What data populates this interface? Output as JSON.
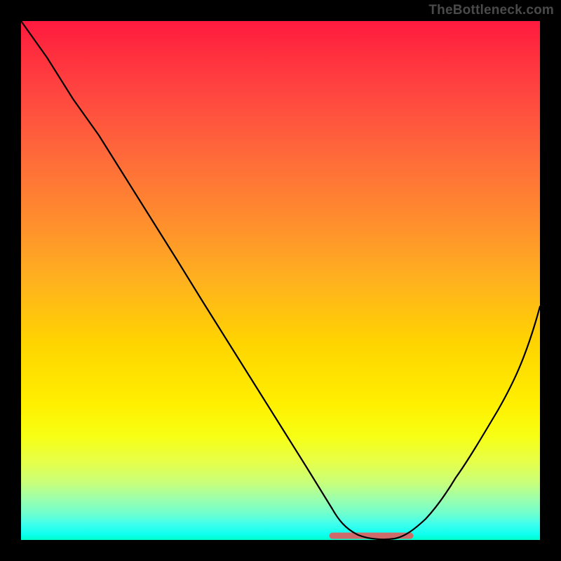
{
  "watermark": "TheBottleneck.com",
  "chart_data": {
    "type": "line",
    "title": "",
    "xlabel": "",
    "ylabel": "",
    "xlim": [
      0,
      100
    ],
    "ylim": [
      0,
      100
    ],
    "grid": false,
    "series": [
      {
        "name": "bottleneck-curve",
        "color": "#000000",
        "x": [
          0,
          5,
          10,
          15,
          20,
          25,
          30,
          35,
          40,
          45,
          50,
          55,
          60,
          62,
          65,
          68,
          72,
          75,
          78,
          82,
          86,
          90,
          94,
          100
        ],
        "values": [
          100,
          93,
          85,
          78,
          70,
          62,
          54,
          46,
          38,
          30,
          22,
          14,
          6,
          3,
          1,
          0,
          0,
          1,
          3,
          8,
          15,
          23,
          31,
          45
        ]
      }
    ],
    "annotations": [
      {
        "name": "optimal-flat-segment",
        "color": "#cf6a6a",
        "x_start": 60,
        "x_end": 75,
        "y": 0.5
      }
    ],
    "background_gradient": {
      "top_color": "#ff1a3f",
      "mid_color": "#fff000",
      "bottom_color": "#00ffc8"
    }
  }
}
